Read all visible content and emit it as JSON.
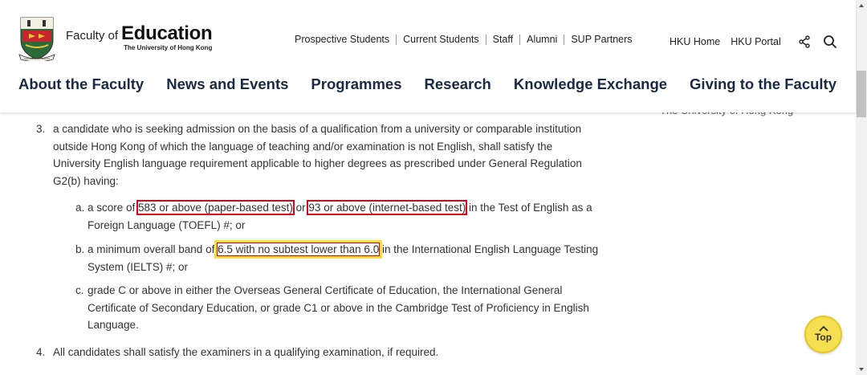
{
  "header": {
    "brand_faculty": "Faculty of",
    "brand_education": "Education",
    "brand_university": "The University of Hong Kong",
    "crest_banner": "SAPIENTIA ET VIRTUS",
    "top_links": [
      "Prospective Students",
      "Current Students",
      "Staff",
      "Alumni",
      "SUP Partners"
    ],
    "util_links": [
      "HKU Home",
      "HKU Portal"
    ],
    "share_icon": "share-icon",
    "search_icon": "search-icon",
    "main_nav": [
      "About the Faculty",
      "News and Events",
      "Programmes",
      "Research",
      "Knowledge Exchange",
      "Giving to the Faculty"
    ]
  },
  "content": {
    "side_text": "The University of Hong Kong",
    "item3": {
      "num": "3.",
      "text": "a candidate who is seeking admission on the basis of a qualification from a university or comparable institution outside Hong Kong of which the language of teaching and/or examination is not English, shall satisfy the University English language requirement applicable to higher degrees as prescribed under General Regulation G2(b) having:"
    },
    "sub_a": {
      "letter": "a.",
      "pre": "a score of ",
      "hl1": "583 or above (paper-based test)",
      "mid": " or ",
      "hl2": "93 or above (internet-based test)",
      "post": " in the Test of English as a Foreign Language (TOEFL) #; or"
    },
    "sub_b": {
      "letter": "b.",
      "pre": "a minimum overall band of ",
      "hl": "6.5 with no subtest lower than 6.0",
      "post": " in the International English Language Testing System (IELTS) #; or"
    },
    "sub_c": {
      "letter": "c.",
      "text": "grade C or above in either the Overseas General Certificate of Education, the International General Certificate of Secondary Education, or grade C1 or above in the Cambridge Test of Proficiency in English Language."
    },
    "item4": {
      "num": "4.",
      "text": "All candidates shall satisfy the examiners in a qualifying examination, if required."
    }
  },
  "top_button": {
    "label": "Top"
  },
  "colors": {
    "highlight_red": "#e0001b",
    "highlight_yellow": "#f2e23a",
    "nav_text": "#1a2a44",
    "top_button": "#f6df50"
  }
}
